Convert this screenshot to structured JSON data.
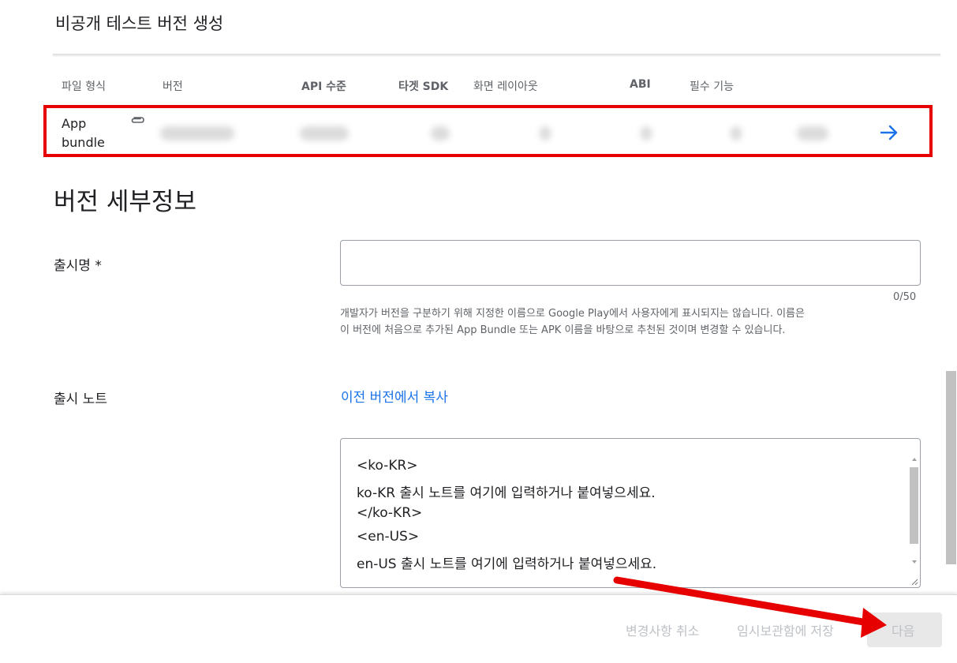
{
  "header": {
    "title": "비공개 테스트 버전 생성"
  },
  "table": {
    "columns": [
      "파일 형식",
      "버전",
      "API 수준",
      "타겟 SDK",
      "화면 레이아웃",
      "ABI",
      "필수 기능"
    ],
    "row": {
      "file_type": "App bundle",
      "file_type_line1": "App",
      "file_type_line2": "bundle"
    }
  },
  "details": {
    "section_title": "버전 세부정보",
    "release_name_label": "출시명 *",
    "release_name_value": "",
    "release_name_counter": "0/50",
    "release_name_help_line1": "개발자가 버전을 구분하기 위해 지정한 이름으로 Google Play에서 사용자에게 표시되지는 않습니다. 이름은",
    "release_name_help_line2": "이 버전에 처음으로 추가된 App Bundle 또는 APK 이름을 바탕으로 추천된 것이며 변경할 수 있습니다.",
    "release_notes_label": "출시 노트",
    "copy_from_previous": "이전 버전에서 복사",
    "release_notes_lines": [
      "<ko-KR>",
      "ko-KR 출시 노트를 여기에 입력하거나 붙여넣으세요.",
      "</ko-KR>",
      "<en-US>",
      "en-US 출시 노트를 여기에 입력하거나 붙여넣으세요."
    ]
  },
  "footer": {
    "discard_label": "변경사항 취소",
    "save_draft_label": "임시보관함에 저장",
    "next_label": "다음"
  },
  "colors": {
    "accent": "#1a73e8",
    "annotation_red": "#e60000"
  },
  "icons": {
    "attachment": "paperclip-icon",
    "open_details": "arrow-right-icon"
  }
}
